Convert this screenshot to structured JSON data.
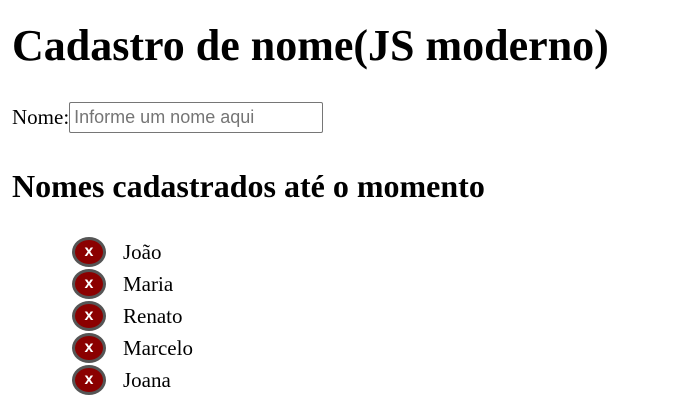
{
  "page": {
    "title": "Cadastro de nome(JS moderno)",
    "list_heading": "Nomes cadastrados até o momento"
  },
  "form": {
    "label": "Nome:",
    "value": "",
    "placeholder": "Informe um nome aqui"
  },
  "names": [
    {
      "name": "João",
      "remove_label": "x"
    },
    {
      "name": "Maria",
      "remove_label": "x"
    },
    {
      "name": "Renato",
      "remove_label": "x"
    },
    {
      "name": "Marcelo",
      "remove_label": "x"
    },
    {
      "name": "Joana",
      "remove_label": "x"
    }
  ],
  "colors": {
    "remove_button_bg": "#8b0000",
    "remove_button_border": "#555555",
    "remove_button_text": "#ffffff"
  },
  "icons": {
    "remove": "close-icon"
  }
}
